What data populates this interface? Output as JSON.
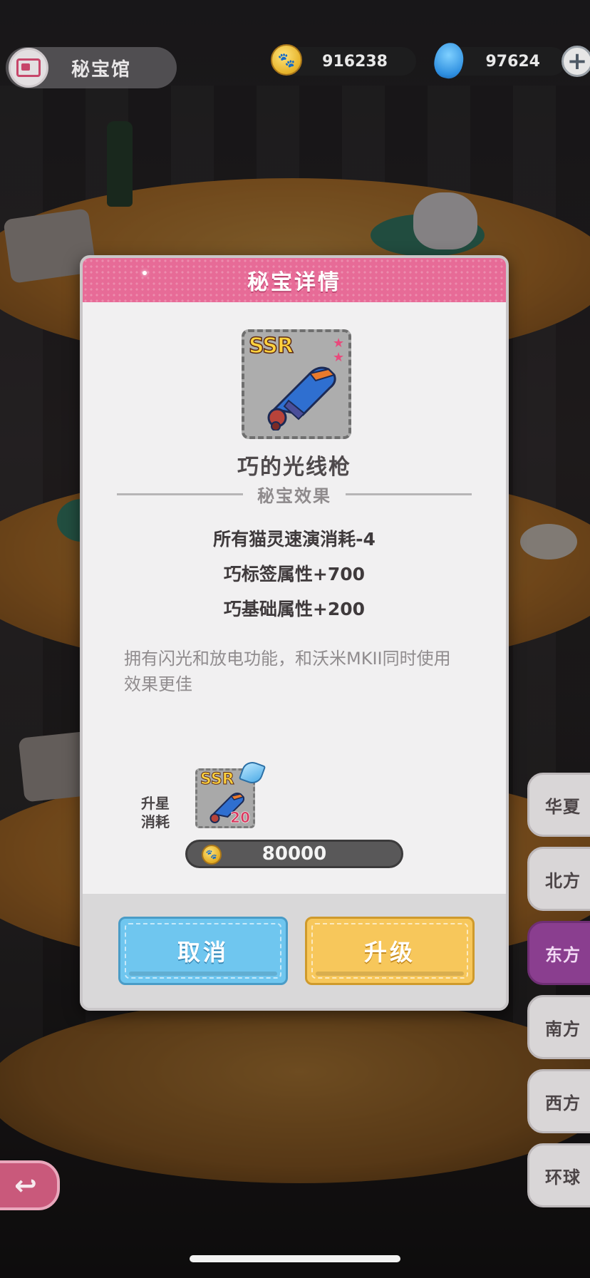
{
  "header": {
    "title": "秘宝馆",
    "coins": "916238",
    "gems": "97624",
    "add_symbol": "+"
  },
  "regions": [
    {
      "label": "华夏",
      "active": false
    },
    {
      "label": "北方",
      "active": false
    },
    {
      "label": "东方",
      "active": true
    },
    {
      "label": "南方",
      "active": false
    },
    {
      "label": "西方",
      "active": false
    },
    {
      "label": "环球",
      "active": false
    }
  ],
  "modal": {
    "title": "秘宝详情",
    "item": {
      "rarity": "SSR",
      "stars": 2,
      "name": "巧的光线枪"
    },
    "section_title": "秘宝效果",
    "effects": [
      "所有猫灵速演消耗-4",
      "巧标签属性+700",
      "巧基础属性+200"
    ],
    "description": "拥有闪光和放电功能，和沃米MKII同时使用效果更佳",
    "cost": {
      "label_line1": "升星",
      "label_line2": "消耗",
      "item_rarity": "SSR",
      "item_count": "20",
      "price": "80000"
    },
    "buttons": {
      "cancel": "取消",
      "upgrade": "升级"
    }
  },
  "colors": {
    "header_pink": "#e76b97",
    "cancel_blue": "#6fc6ef",
    "upgrade_yellow": "#f7c75b",
    "active_region": "#8a3e8f"
  }
}
